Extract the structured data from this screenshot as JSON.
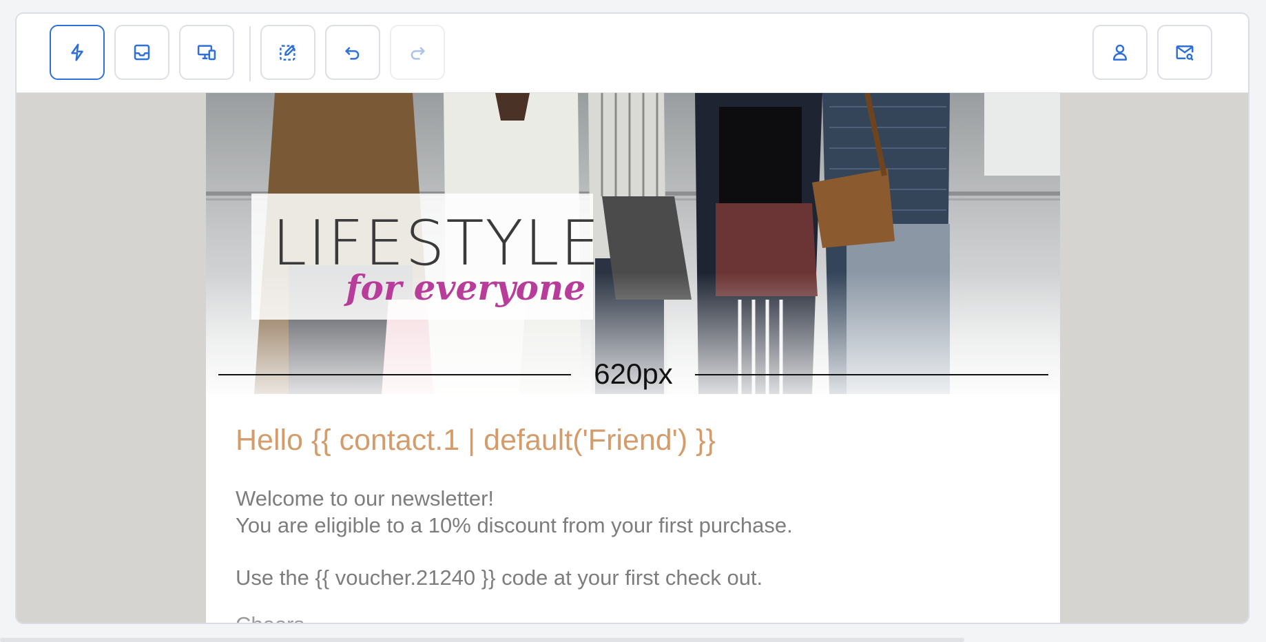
{
  "toolbar": {
    "left_buttons": [
      {
        "name": "lightning-button",
        "icon": "lightning-icon",
        "active": true,
        "disabled": false
      },
      {
        "name": "inbox-button",
        "icon": "inbox-icon",
        "active": false,
        "disabled": false
      },
      {
        "name": "responsive-preview-button",
        "icon": "devices-icon",
        "active": false,
        "disabled": false
      },
      {
        "name": "edit-selection-button",
        "icon": "edit-dashed-icon",
        "active": false,
        "disabled": false
      },
      {
        "name": "undo-button",
        "icon": "undo-icon",
        "active": false,
        "disabled": false
      },
      {
        "name": "redo-button",
        "icon": "redo-icon",
        "active": false,
        "disabled": true
      }
    ],
    "right_buttons": [
      {
        "name": "contact-button",
        "icon": "user-icon"
      },
      {
        "name": "email-preview-button",
        "icon": "mail-search-icon"
      }
    ],
    "accent_color": "#2f6fdb"
  },
  "email": {
    "banner": {
      "logo_main": "LIFESTYLE",
      "logo_sub": "for everyone",
      "size_label": "620px"
    },
    "greeting": "Hello {{ contact.1 | default('Friend') }}",
    "lines": [
      "Welcome to our newsletter!",
      "You are eligible to a 10% discount from your first purchase.",
      "Use the {{ voucher.21240 }} code at your first check out."
    ],
    "partial_line": "Cheers,",
    "colors": {
      "greeting": "#d49c6b",
      "body": "#7d7d7d",
      "logo_accent": "#b83c9a"
    }
  }
}
